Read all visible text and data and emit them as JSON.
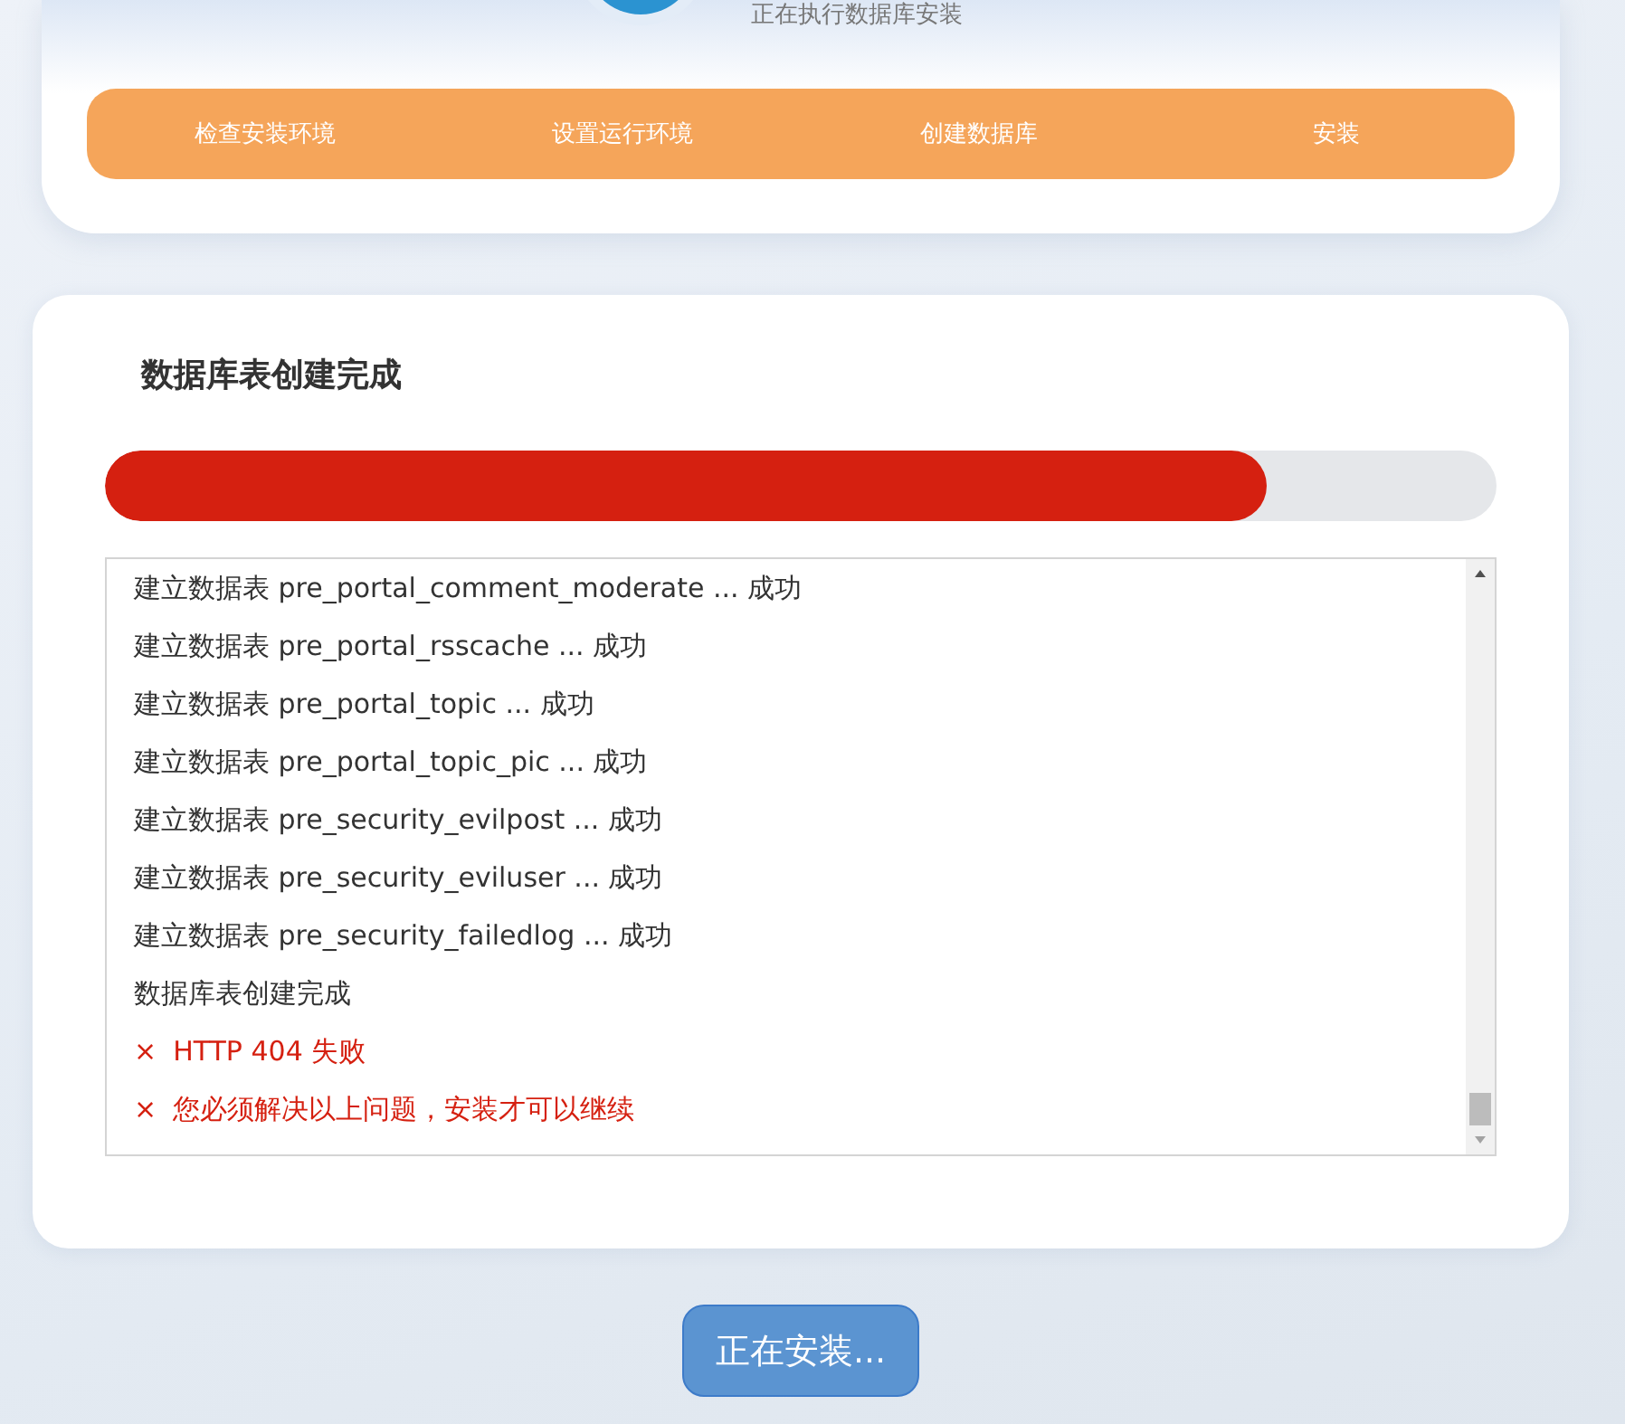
{
  "header": {
    "subtitle": "正在执行数据库安装"
  },
  "steps": [
    {
      "label": "检查安装环境"
    },
    {
      "label": "设置运行环境"
    },
    {
      "label": "创建数据库"
    },
    {
      "label": "安装"
    }
  ],
  "progress": {
    "title": "数据库表创建完成",
    "level": 0.835
  },
  "log": [
    {
      "kind": "ok",
      "text": "建立数据表 pre_portal_comment_moderate ... 成功"
    },
    {
      "kind": "ok",
      "text": "建立数据表 pre_portal_rsscache ... 成功"
    },
    {
      "kind": "ok",
      "text": "建立数据表 pre_portal_topic ... 成功"
    },
    {
      "kind": "ok",
      "text": "建立数据表 pre_portal_topic_pic ... 成功"
    },
    {
      "kind": "ok",
      "text": "建立数据表 pre_security_evilpost ... 成功"
    },
    {
      "kind": "ok",
      "text": "建立数据表 pre_security_eviluser ... 成功"
    },
    {
      "kind": "ok",
      "text": "建立数据表 pre_security_failedlog ... 成功"
    },
    {
      "kind": "ok",
      "text": "数据库表创建完成"
    },
    {
      "kind": "error",
      "mark": "×",
      "text": "HTTP 404 失败"
    },
    {
      "kind": "error",
      "mark": "×",
      "text": "您必须解决以上问题，安装才可以继续"
    }
  ],
  "button": {
    "label": "正在安装..."
  }
}
